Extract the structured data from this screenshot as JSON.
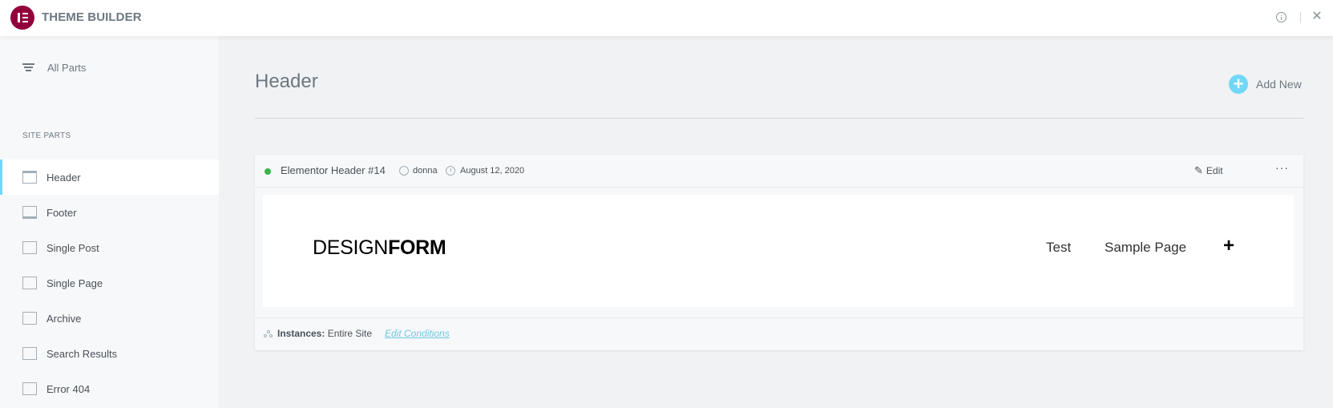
{
  "app": {
    "title": "THEME BUILDER"
  },
  "sidebar": {
    "all_parts_label": "All Parts",
    "section_label": "SITE PARTS",
    "items": [
      {
        "label": "Header",
        "icon": "header-layout-icon",
        "active": true
      },
      {
        "label": "Footer",
        "icon": "footer-layout-icon",
        "active": false
      },
      {
        "label": "Single Post",
        "icon": "single-post-icon",
        "active": false
      },
      {
        "label": "Single Page",
        "icon": "single-page-icon",
        "active": false
      },
      {
        "label": "Archive",
        "icon": "archive-icon",
        "active": false
      },
      {
        "label": "Search Results",
        "icon": "search-results-icon",
        "active": false
      },
      {
        "label": "Error 404",
        "icon": "error-404-icon",
        "active": false
      }
    ]
  },
  "main": {
    "title": "Header",
    "add_new_label": "Add New",
    "card": {
      "status": "published",
      "title": "Elementor Header #14",
      "author": "donna",
      "date": "August 12, 2020",
      "edit_label": "Edit",
      "more_label": "···",
      "preview": {
        "brand_light": "DESIGN",
        "brand_bold": "FORM",
        "nav_1": "Test",
        "nav_2": "Sample Page",
        "plus": "+"
      },
      "instances_label": "Instances:",
      "instances_value": "Entire Site",
      "edit_conditions_label": "Edit Conditions"
    }
  },
  "colors": {
    "brand": "#92003b",
    "accent": "#71d7f7",
    "status_green": "#39b54a",
    "link": "#71c6e3"
  }
}
